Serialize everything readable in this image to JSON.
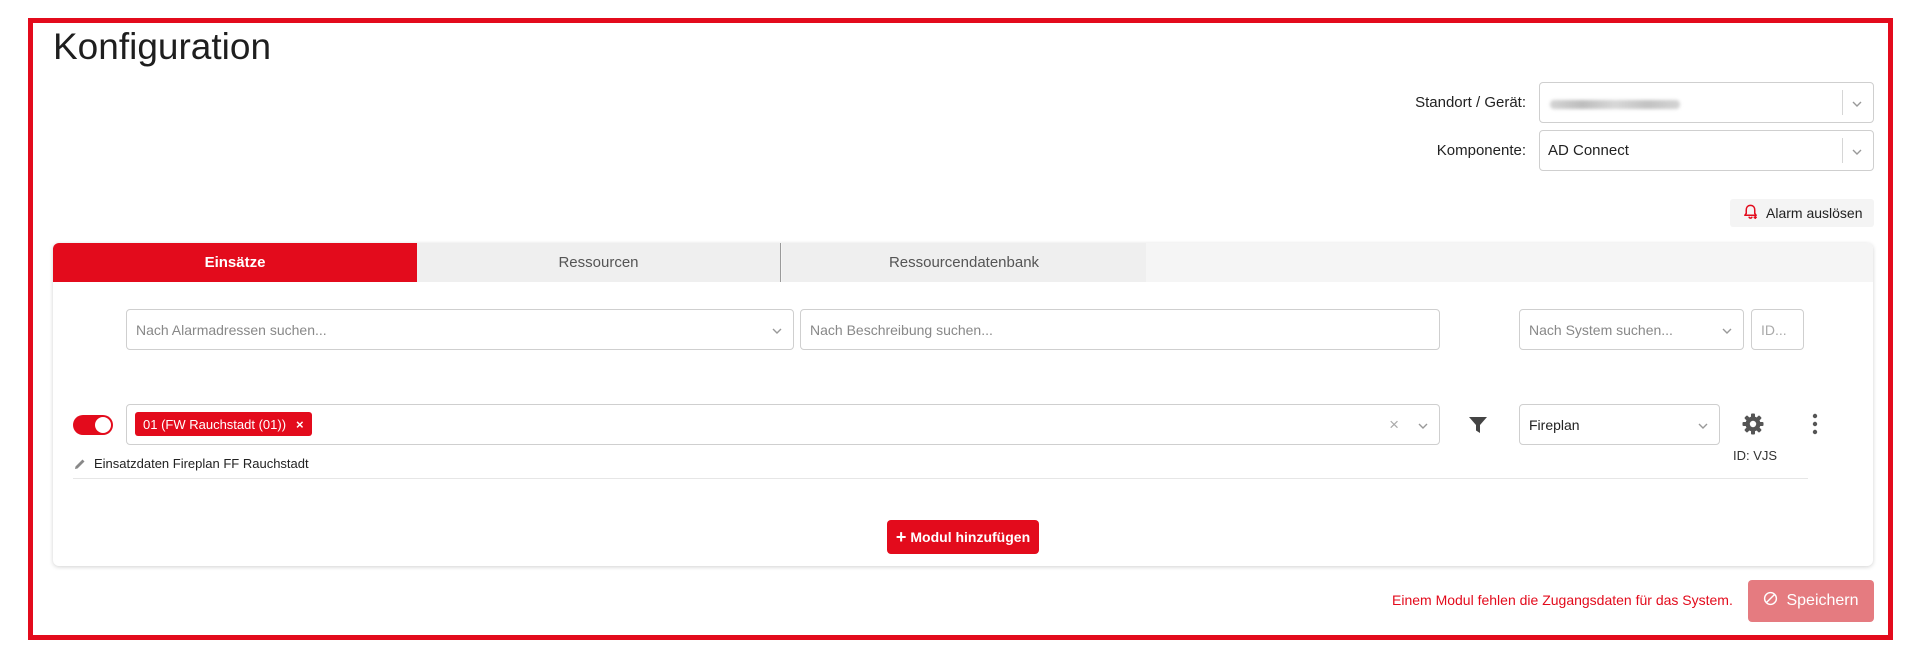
{
  "page": {
    "title": "Konfiguration"
  },
  "header": {
    "location_label": "Standort / Gerät:",
    "location_value": "",
    "component_label": "Komponente:",
    "component_value": "AD Connect",
    "alarm_button": "Alarm auslösen"
  },
  "tabs": [
    {
      "label": "Einsätze",
      "active": true
    },
    {
      "label": "Ressourcen",
      "active": false
    },
    {
      "label": "Ressourcendatenbank",
      "active": false
    }
  ],
  "filters": {
    "alarm_addresses_placeholder": "Nach Alarmadressen suchen...",
    "description_placeholder": "Nach Beschreibung suchen...",
    "system_placeholder": "Nach System suchen...",
    "id_placeholder": "ID..."
  },
  "module": {
    "enabled": true,
    "tag_label": "01 (FW Rauchstadt (01))",
    "tag_remove": "×",
    "clear_symbol": "×",
    "system_value": "Fireplan",
    "id_text": "ID: VJS",
    "description": "Einsatzdaten Fireplan FF Rauchstadt"
  },
  "actions": {
    "add_module": "Modul hinzufügen",
    "add_symbol": "+",
    "error_message": "Einem Modul fehlen die Zugangsdaten für das System.",
    "save": "Speichern"
  },
  "colors": {
    "accent": "#e30b1c",
    "save_disabled": "#e57b80",
    "tab_inactive": "#efefef"
  }
}
